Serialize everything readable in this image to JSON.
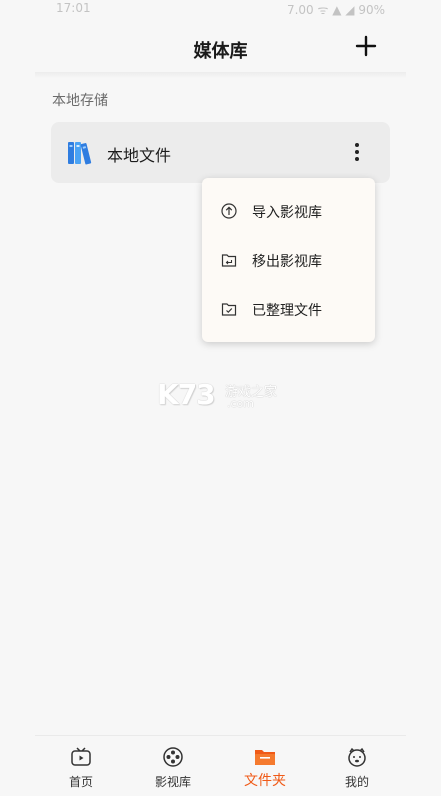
{
  "status_bar": {
    "time": "17:01",
    "right": "7.00 ᯤ ▲ ◢ 90%"
  },
  "header": {
    "title": "媒体库",
    "add_icon": "plus-icon"
  },
  "section": {
    "title": "本地存储"
  },
  "local_files": {
    "name": "本地文件",
    "icon": "books-folder-icon",
    "more_icon": "more-vertical-icon"
  },
  "context_menu": {
    "items": [
      {
        "label": "导入影视库",
        "icon": "upload-icon"
      },
      {
        "label": "移出影视库",
        "icon": "folder-return-icon"
      },
      {
        "label": "已整理文件",
        "icon": "folder-check-icon"
      }
    ]
  },
  "watermark": {
    "brand": "K73",
    "text": "游戏之家",
    "domain": ".com"
  },
  "tabs": [
    {
      "label": "首页",
      "icon": "tv-icon"
    },
    {
      "label": "影视库",
      "icon": "film-reel-icon"
    },
    {
      "label": "文件夹",
      "icon": "folder-icon",
      "active": true
    },
    {
      "label": "我的",
      "icon": "bear-face-icon"
    }
  ],
  "colors": {
    "accent": "#f05a17",
    "card_bg": "#ececec",
    "menu_bg": "#fdfaf6",
    "page_bg": "#f7f7f7"
  }
}
